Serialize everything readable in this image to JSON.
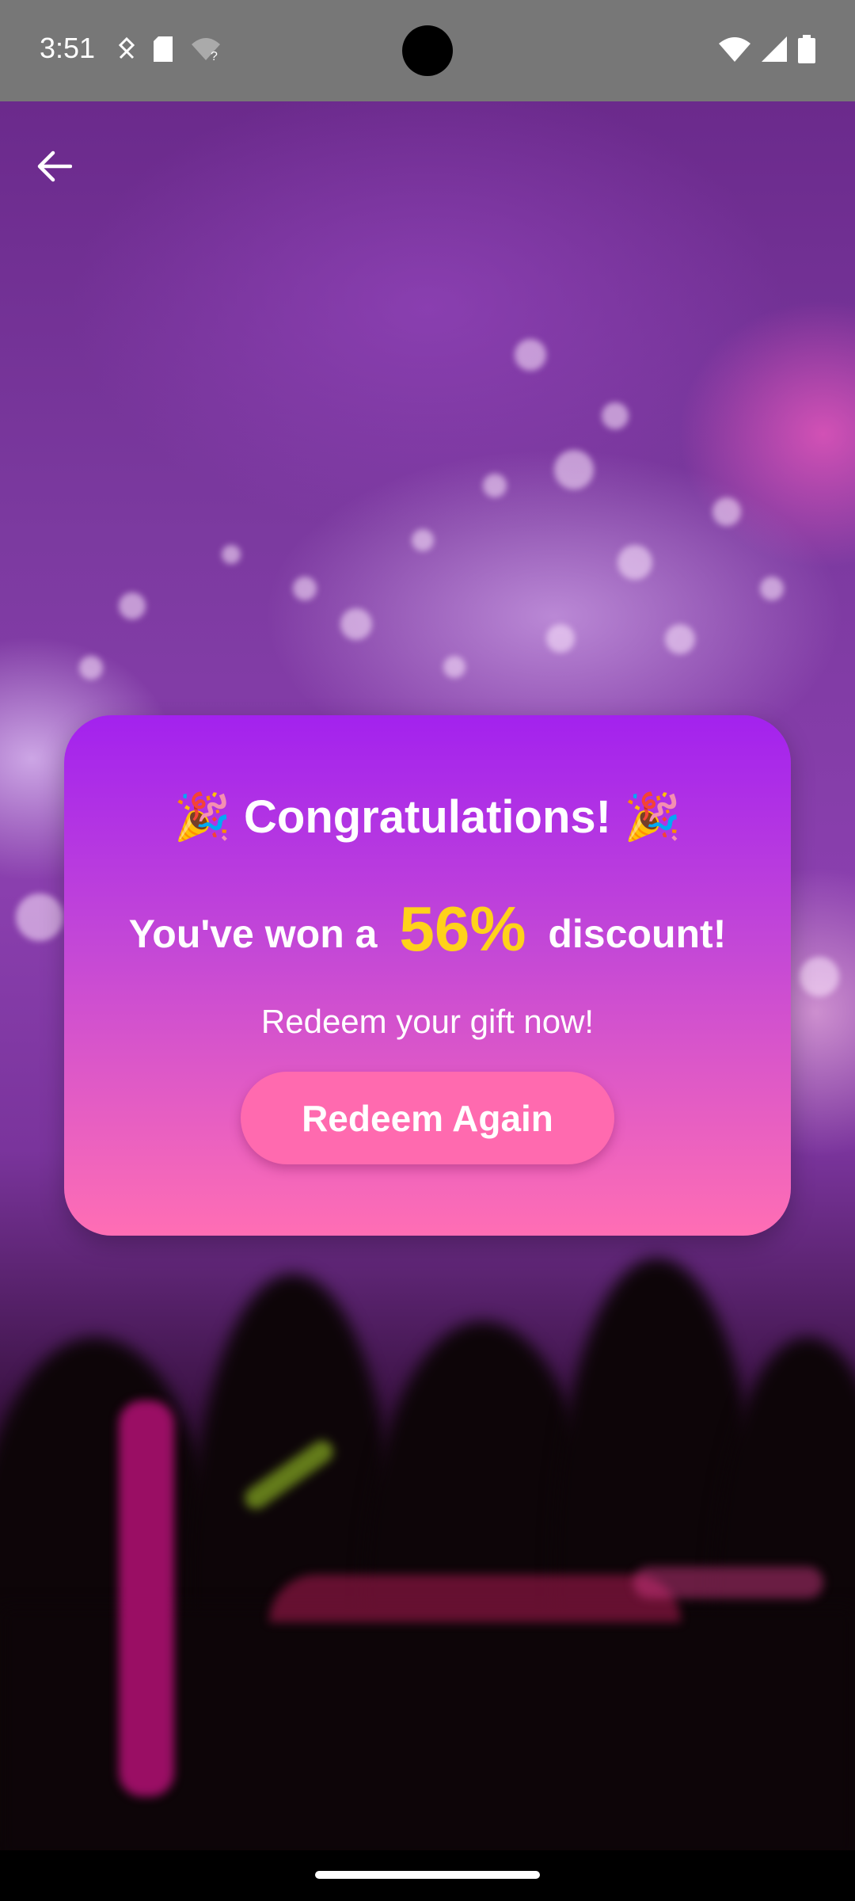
{
  "status_bar": {
    "time": "3:51",
    "left_icons": [
      "nfc-icon",
      "sd-card-icon",
      "wifi-question-icon"
    ],
    "right_icons": [
      "wifi-icon",
      "signal-icon",
      "battery-icon"
    ]
  },
  "nav": {
    "back_icon": "arrow-left-icon"
  },
  "dialog": {
    "title": "🎉 Congratulations! 🎉",
    "discount_prefix": "You've won a",
    "discount_value": "56%",
    "discount_suffix": "discount!",
    "subtitle": "Redeem your gift now!",
    "button_label": "Redeem Again"
  },
  "colors": {
    "card_top": "#a322ee",
    "card_bottom": "#ff6eb4",
    "discount_highlight": "#ffd21a",
    "button": "#ff6aaf",
    "status_bar": "#777777"
  }
}
